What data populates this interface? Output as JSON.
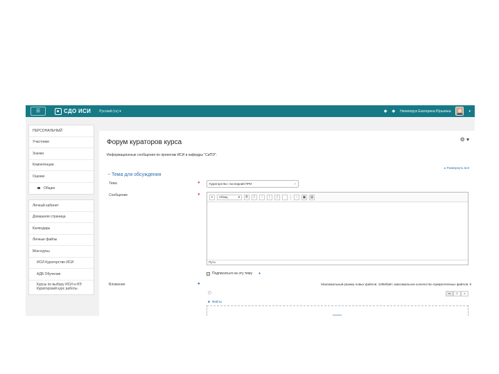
{
  "navbar": {
    "toggle_icon": "menu-icon",
    "logo_text": "СДО ИСИ",
    "language": "Русский (ru) ▾",
    "bell_icon": "◆",
    "message_icon": "◆",
    "user_name": "Ничипорук Екатерина Юрьевна",
    "caret": "▾"
  },
  "sidebar": {
    "group1": [
      {
        "label": "ПЕРСОНАЛЬНЫЙ",
        "sub": false,
        "folder": false
      },
      {
        "label": "Участники",
        "sub": false,
        "folder": false
      },
      {
        "label": "Значки",
        "sub": false,
        "folder": false
      },
      {
        "label": "Компетенции",
        "sub": false,
        "folder": false
      },
      {
        "label": "Оценки",
        "sub": false,
        "folder": false
      },
      {
        "label": "Общее",
        "sub": true,
        "folder": true
      }
    ],
    "group2": [
      {
        "label": "Личный кабинет",
        "sub": false,
        "tall": false
      },
      {
        "label": "Домашняя страница",
        "sub": false,
        "tall": false
      },
      {
        "label": "Календарь",
        "sub": false,
        "tall": false
      },
      {
        "label": "Личные файлы",
        "sub": false,
        "tall": false
      },
      {
        "label": "Мои курсы",
        "sub": false,
        "tall": false
      },
      {
        "label": "ИСИ Кураторство ИСИ",
        "sub": true,
        "tall": false
      },
      {
        "label": "АДБ Обучение",
        "sub": true,
        "tall": false
      },
      {
        "label": "Курсы по выбору ИСИ и ИЭ Кураторский курс работы",
        "sub": true,
        "tall": true
      }
    ]
  },
  "main": {
    "title": "Форум кураторов курса",
    "description": "Информационные сообщения по проектам ИСИ и кафедры \"СиПЭ\".",
    "collapse_link": "▸ Развернуть всё",
    "section_title": "− Тема для обсуждения",
    "subject_label": "Тема",
    "subject_value": "Кураторство: последний ПРИ",
    "message_label": "Сообщение",
    "editor_font": "Абзац",
    "editor_path": "Путь:",
    "subscribe_label": "Подписаться на эту тему",
    "subscribe_checked": "✓",
    "attachment_label": "Вложение",
    "max_size": "Максимальный размер новых файлов: 100Мбайт, максимальное количество прикрепленных файлов: 9",
    "files_folder": "Файлы"
  },
  "colors": {
    "navbar": "#167a86",
    "link": "#2a6fb0",
    "required": "#d9534f"
  }
}
